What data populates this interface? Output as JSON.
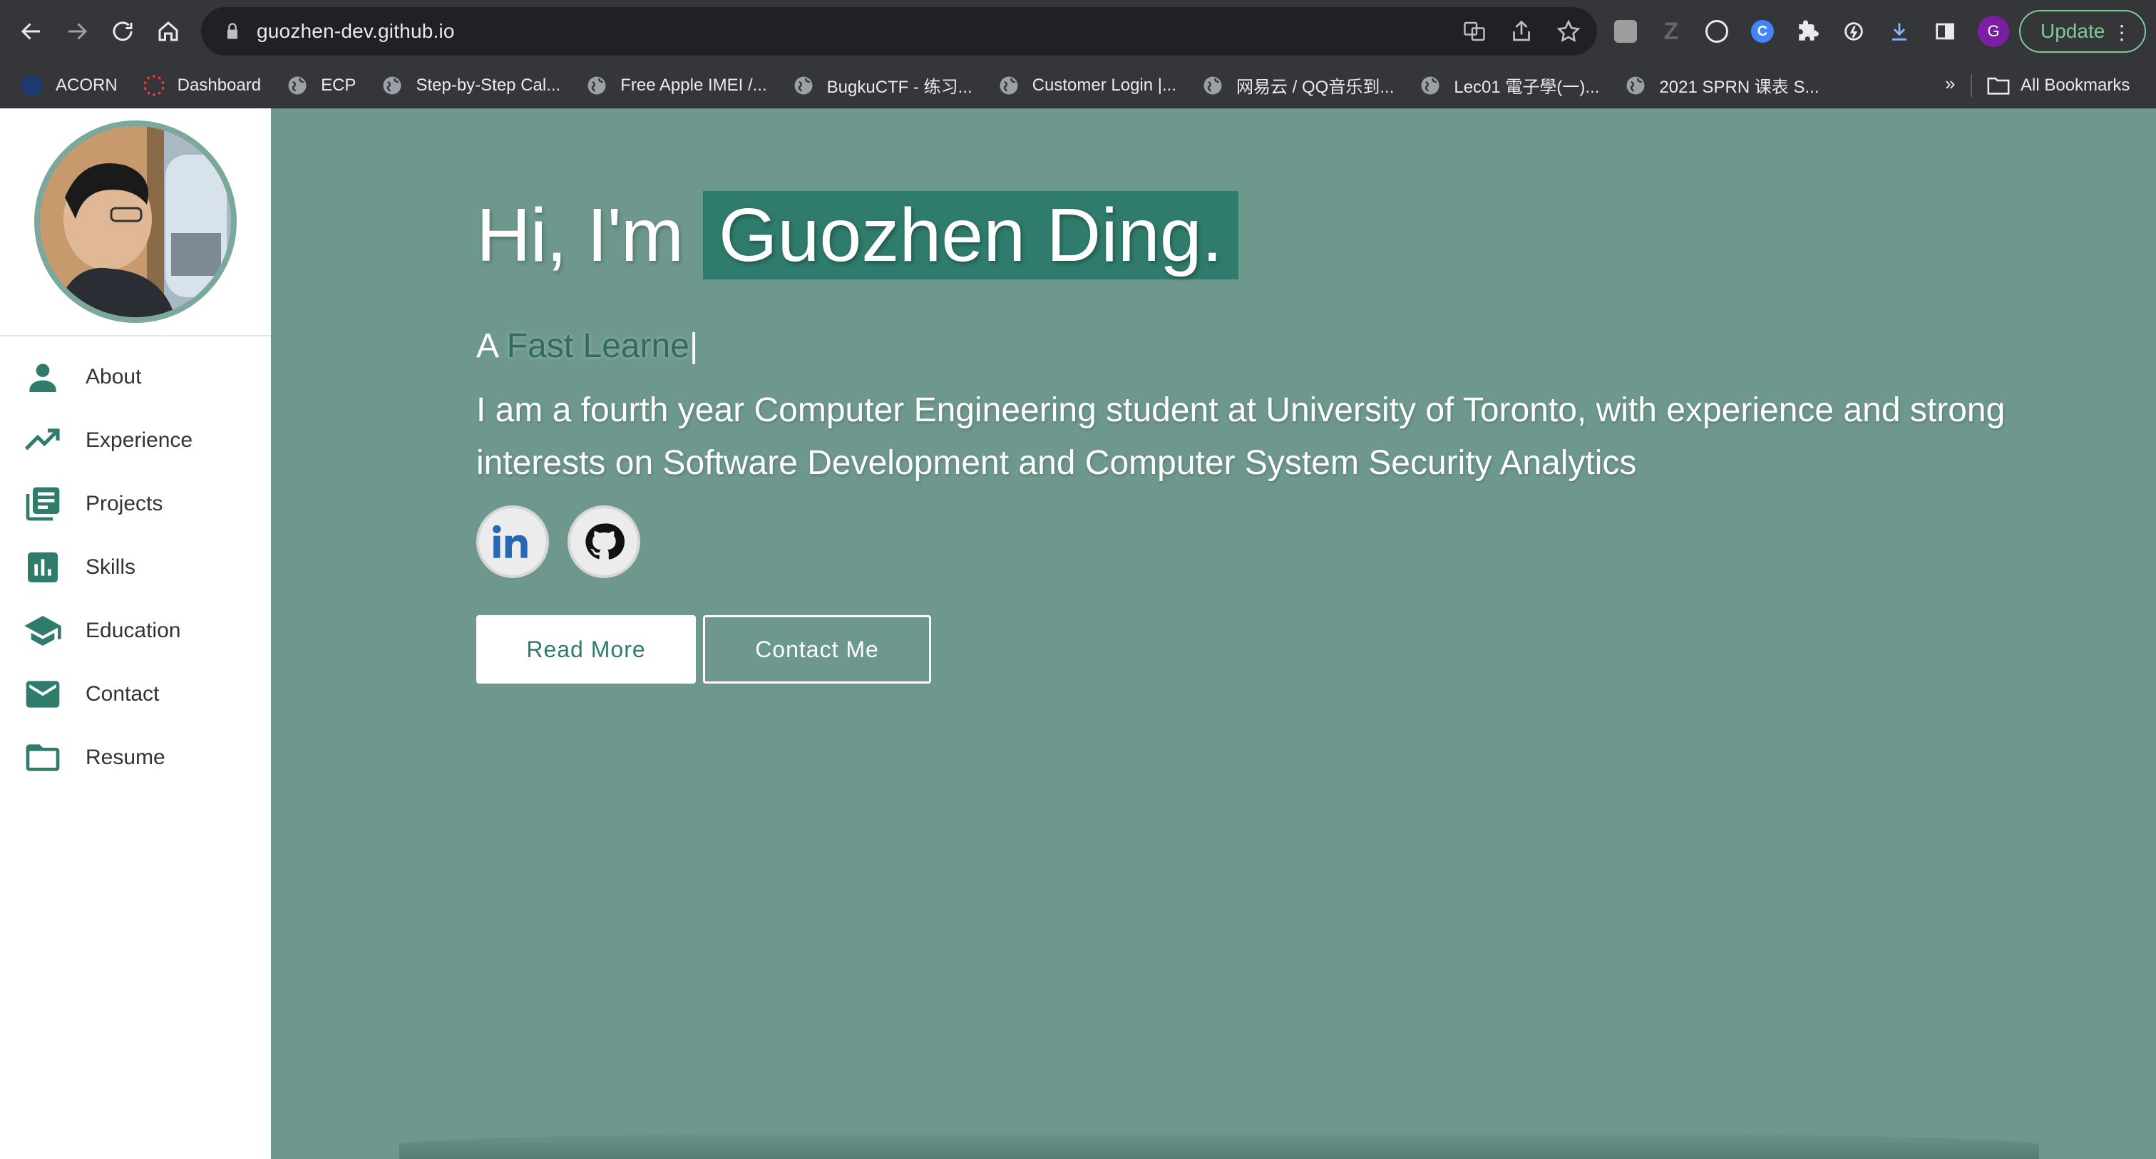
{
  "browser": {
    "url": "guozhen-dev.github.io",
    "update_label": "Update",
    "profile_initial": "G",
    "bookmarks": [
      {
        "label": "ACORN"
      },
      {
        "label": "Dashboard"
      },
      {
        "label": "ECP"
      },
      {
        "label": "Step-by-Step Cal..."
      },
      {
        "label": "Free Apple IMEI /..."
      },
      {
        "label": "BugkuCTF - 练习..."
      },
      {
        "label": "Customer Login |..."
      },
      {
        "label": "网易云 / QQ音乐到..."
      },
      {
        "label": "Lec01 電子學(一)..."
      },
      {
        "label": "2021 SPRN 课表 S..."
      }
    ],
    "more_label": "»",
    "all_bookmarks_label": "All Bookmarks"
  },
  "sidebar": {
    "items": [
      {
        "label": "About",
        "icon": "person-icon"
      },
      {
        "label": "Experience",
        "icon": "trending-up-icon"
      },
      {
        "label": "Projects",
        "icon": "library-books-icon"
      },
      {
        "label": "Skills",
        "icon": "bar-chart-icon"
      },
      {
        "label": "Education",
        "icon": "school-icon"
      },
      {
        "label": "Contact",
        "icon": "email-icon"
      },
      {
        "label": "Resume",
        "icon": "folder-icon"
      }
    ]
  },
  "hero": {
    "greeting": "Hi, I'm",
    "name": "Guozhen Ding.",
    "tagline_prefix": "A",
    "tagline_role": "Fast Learne",
    "caret": "|",
    "bio": "I am a fourth year Computer Engineering student at University of Toronto, with experience and strong interests on Software Development and Computer System Security Analytics",
    "read_more_label": "Read More",
    "contact_label": "Contact Me"
  },
  "colors": {
    "accent": "#2f7b6c",
    "hero_bg": "#6e988d",
    "sidebar_bg": "#ffffff"
  }
}
